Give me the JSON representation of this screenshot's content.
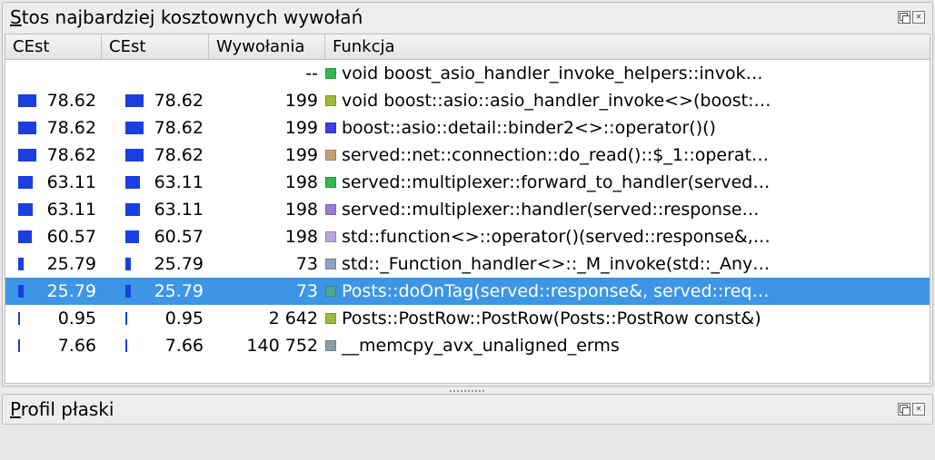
{
  "panels": {
    "top": {
      "title_prefix_underlined_char": "S",
      "title_rest": "tos najbardziej kosztownych wywołań"
    },
    "bottom": {
      "title_prefix_underlined_char": "P",
      "title_rest": "rofil płaski"
    }
  },
  "columns": {
    "c1": "CEst",
    "c2": "CEst",
    "c3": "Wywołania",
    "c4": "Funkcja"
  },
  "icon_colors": {
    "green": "#2fb84f",
    "olive": "#9bbb3a",
    "blue": "#3a3fe0",
    "tan": "#c8a070",
    "teal": "#4fa98f",
    "purple": "#9a7bd4",
    "lightpurple": "#b9a8dc",
    "grayblue": "#8fa3c0",
    "slate": "#8d9ea8"
  },
  "rows": [
    {
      "cost1": null,
      "cost2": null,
      "calls": "--",
      "color": "green",
      "func": "void boost_asio_handler_invoke_helpers::invok…",
      "selected": false
    },
    {
      "cost1": 78.62,
      "cost2": 78.62,
      "calls": "199",
      "color": "olive",
      "func": "void boost::asio::asio_handler_invoke<>(boost:…",
      "selected": false
    },
    {
      "cost1": 78.62,
      "cost2": 78.62,
      "calls": "199",
      "color": "blue",
      "func": "boost::asio::detail::binder2<>::operator()()",
      "selected": false
    },
    {
      "cost1": 78.62,
      "cost2": 78.62,
      "calls": "199",
      "color": "tan",
      "func": "served::net::connection::do_read()::$_1::operat…",
      "selected": false
    },
    {
      "cost1": 63.11,
      "cost2": 63.11,
      "calls": "198",
      "color": "green",
      "func": "served::multiplexer::forward_to_handler(served…",
      "selected": false
    },
    {
      "cost1": 63.11,
      "cost2": 63.11,
      "calls": "198",
      "color": "purple",
      "func": "served::multiplexer::handler(served::response…",
      "selected": false
    },
    {
      "cost1": 60.57,
      "cost2": 60.57,
      "calls": "198",
      "color": "lightpurple",
      "func": "std::function<>::operator()(served::response&,…",
      "selected": false
    },
    {
      "cost1": 25.79,
      "cost2": 25.79,
      "calls": "73",
      "color": "grayblue",
      "func": "std::_Function_handler<>::_M_invoke(std::_Any…",
      "selected": false
    },
    {
      "cost1": 25.79,
      "cost2": 25.79,
      "calls": "73",
      "color": "teal",
      "func": "Posts::doOnTag(served::response&, served::req…",
      "selected": true
    },
    {
      "cost1": 0.95,
      "cost2": 0.95,
      "calls": "2 642",
      "color": "olive",
      "func": "Posts::PostRow::PostRow(Posts::PostRow const&)",
      "selected": false
    },
    {
      "cost1": 7.66,
      "cost2": 7.66,
      "calls": "140 752",
      "color": "slate",
      "func": "__memcpy_avx_unaligned_erms",
      "selected": false
    }
  ]
}
